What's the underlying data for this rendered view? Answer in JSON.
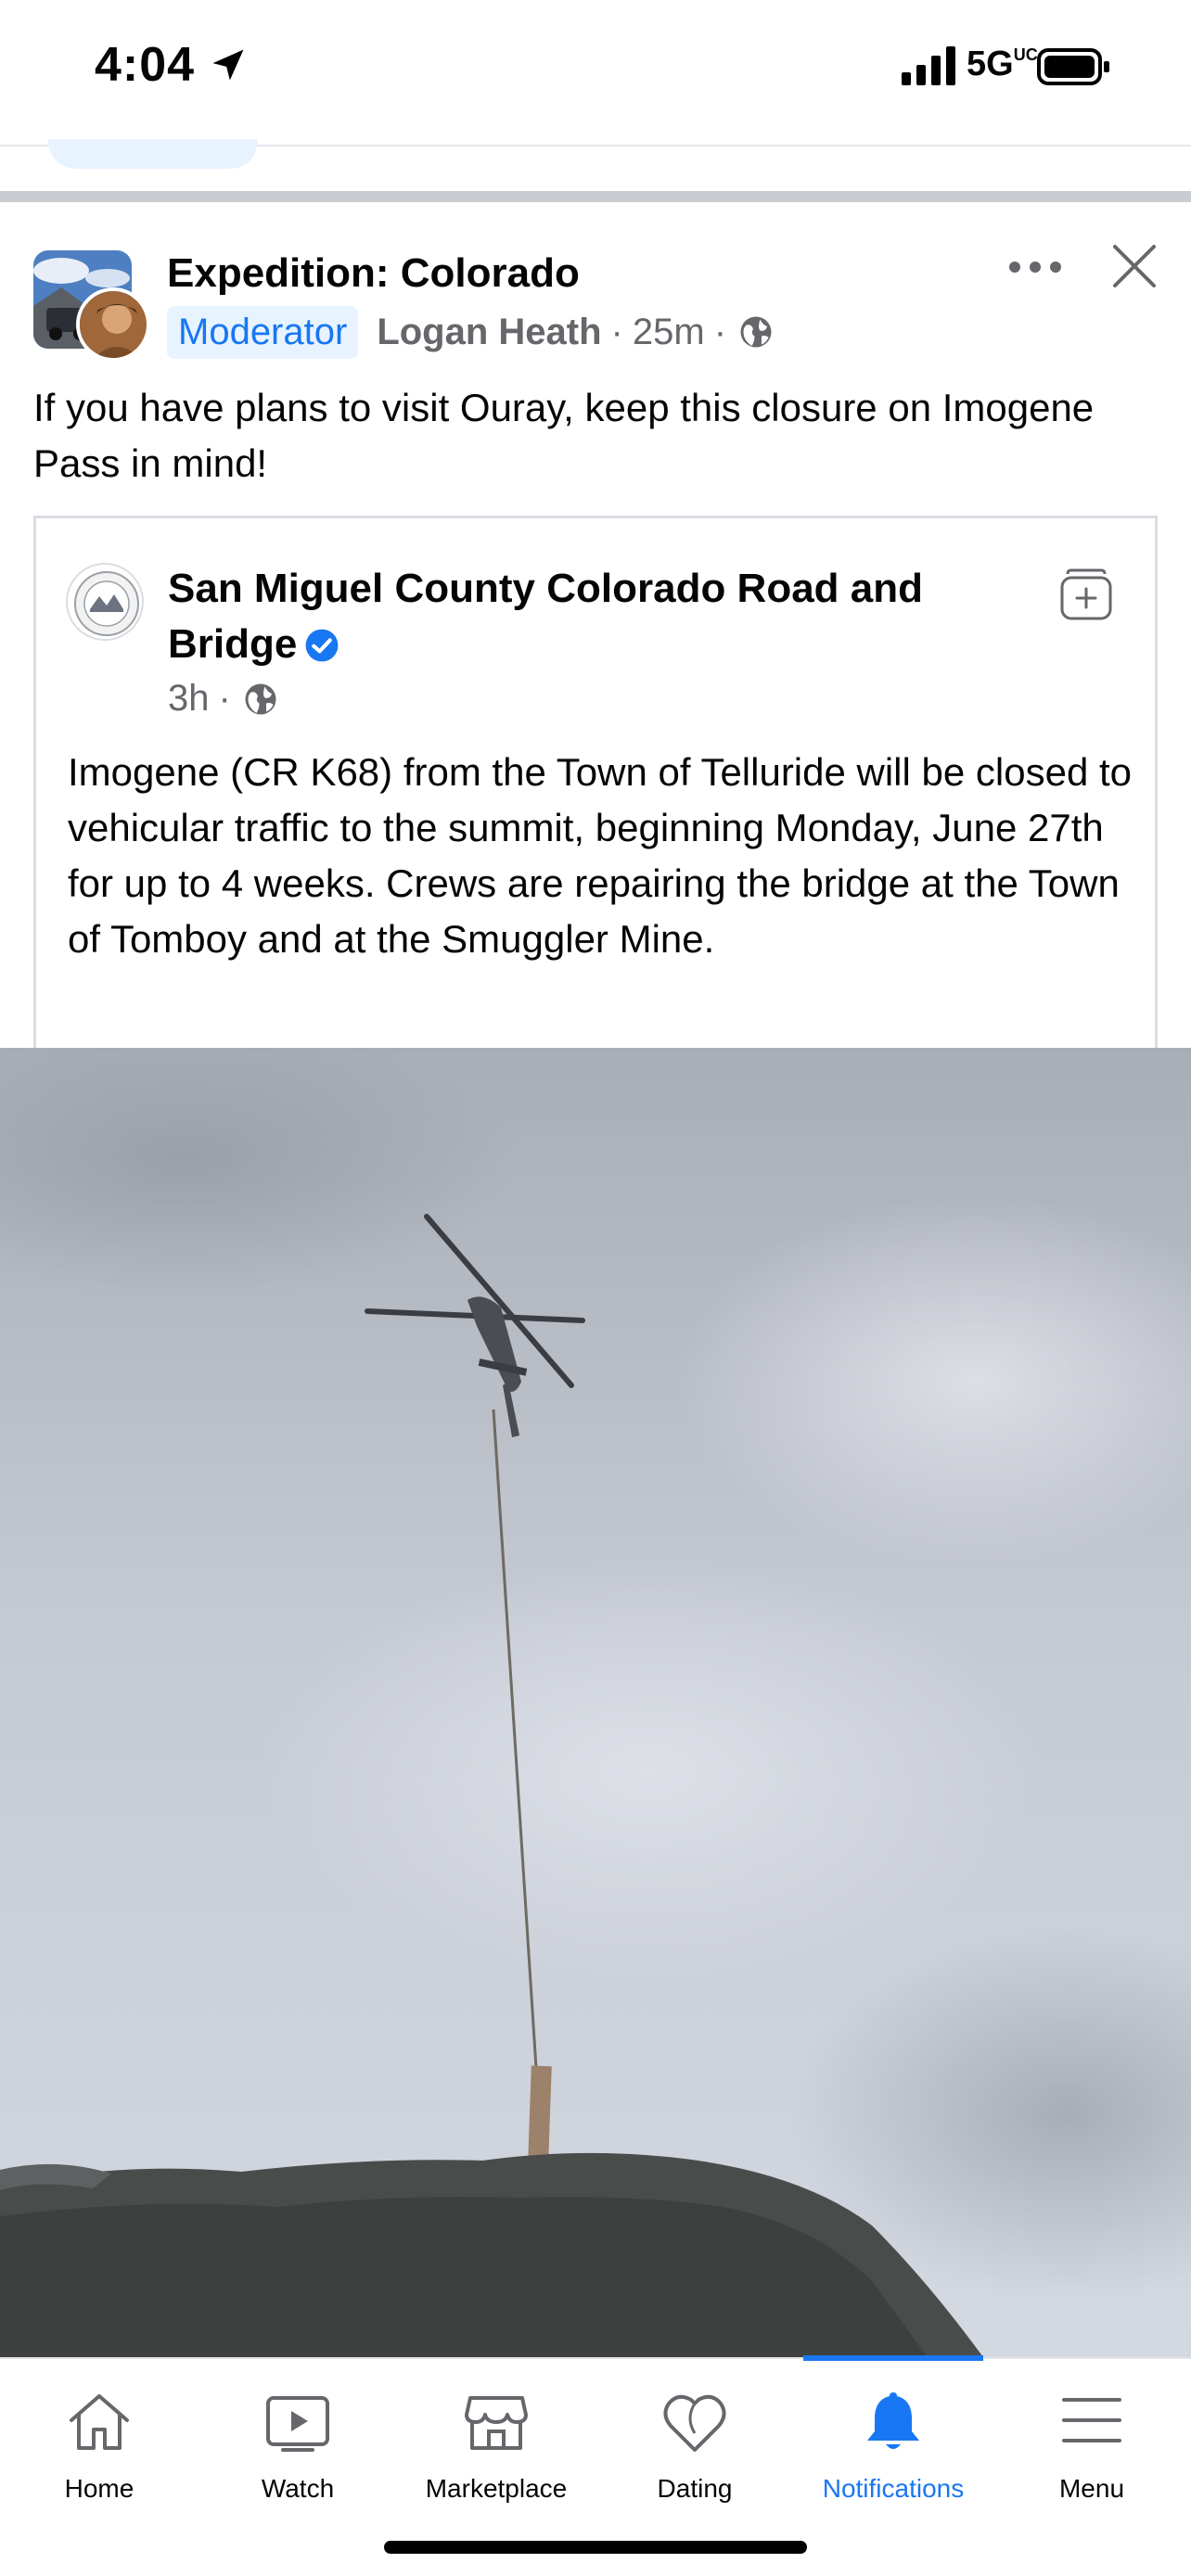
{
  "status_bar": {
    "time": "4:04",
    "network": "5G",
    "network_suffix": "UC"
  },
  "post": {
    "group_name": "Expedition: Colorado",
    "role_badge": "Moderator",
    "author": "Logan Heath",
    "time": "25m",
    "text": "If you have plans to visit Ouray, keep this closure on Imogene Pass in mind!"
  },
  "shared_post": {
    "page_name": "San Miguel County Colorado Road and Bridge",
    "time": "3h",
    "text": "Imogene (CR K68) from the Town of Telluride will be closed to vehicular traffic to the summit, beginning Monday, June 27th for up to 4 weeks.   Crews are repairing the bridge at the Town of Tomboy and at the Smuggler Mine."
  },
  "bottom_nav": {
    "items": [
      {
        "label": "Home",
        "icon": "home-icon"
      },
      {
        "label": "Watch",
        "icon": "watch-icon"
      },
      {
        "label": "Marketplace",
        "icon": "marketplace-icon"
      },
      {
        "label": "Dating",
        "icon": "dating-icon"
      },
      {
        "label": "Notifications",
        "icon": "bell-icon",
        "active": true
      },
      {
        "label": "Menu",
        "icon": "menu-icon"
      }
    ]
  },
  "colors": {
    "accent": "#1877f2",
    "secondary_text": "#65676b",
    "divider": "#c9ccd1"
  }
}
